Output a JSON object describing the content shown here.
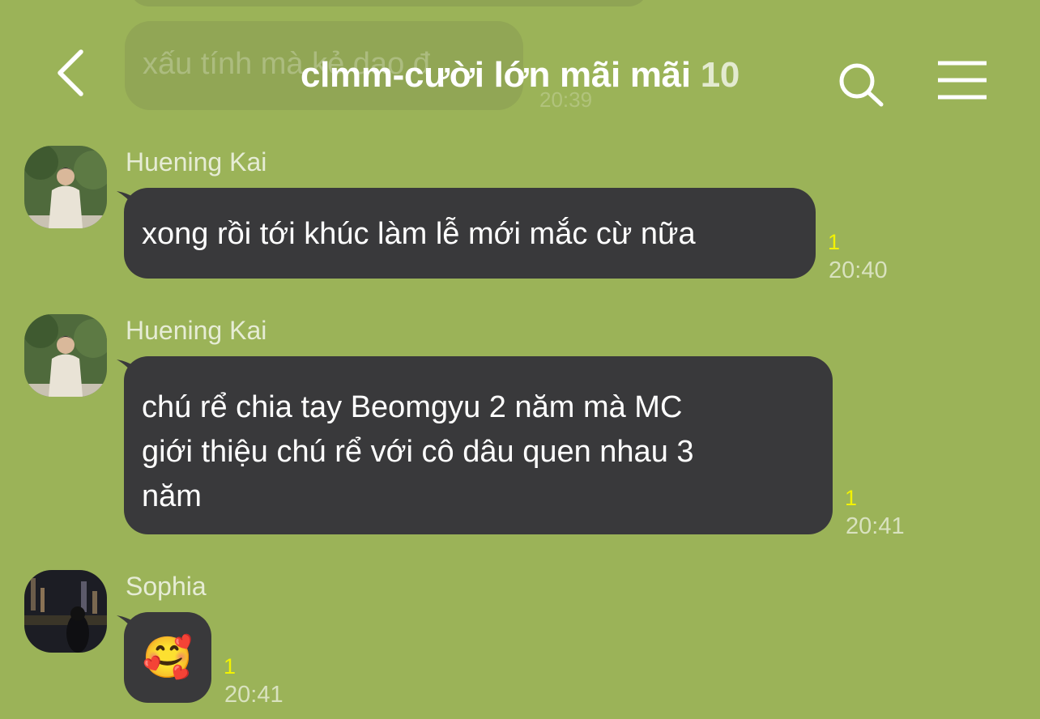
{
  "previous_message": {
    "text": "xấu tính mà kẻ dạo đ",
    "time": "20:39"
  },
  "header": {
    "title": "clmm-cười lớn mãi mãi",
    "member_count": "10",
    "back_icon": "chevron-left-icon",
    "search_icon": "search-icon",
    "menu_icon": "hamburger-menu-icon"
  },
  "messages": [
    {
      "sender": "Huening Kai",
      "lines": [
        "xong rồi tới khúc làm lễ mới mắc cừ nữa"
      ],
      "read_count": "1",
      "time": "20:40"
    },
    {
      "sender": "Huening Kai",
      "lines": [
        "chú rể chia tay Beomgyu 2 năm mà MC",
        "giới thiệu chú rể với cô dâu quen nhau 3",
        "năm"
      ],
      "read_count": "1",
      "time": "20:41"
    },
    {
      "sender": "Sophia",
      "lines": [
        "🥰"
      ],
      "read_count": "1",
      "time": "20:41"
    }
  ],
  "colors": {
    "background": "#9bb358",
    "bubble": "#39393b",
    "read_count": "#f2f200"
  }
}
